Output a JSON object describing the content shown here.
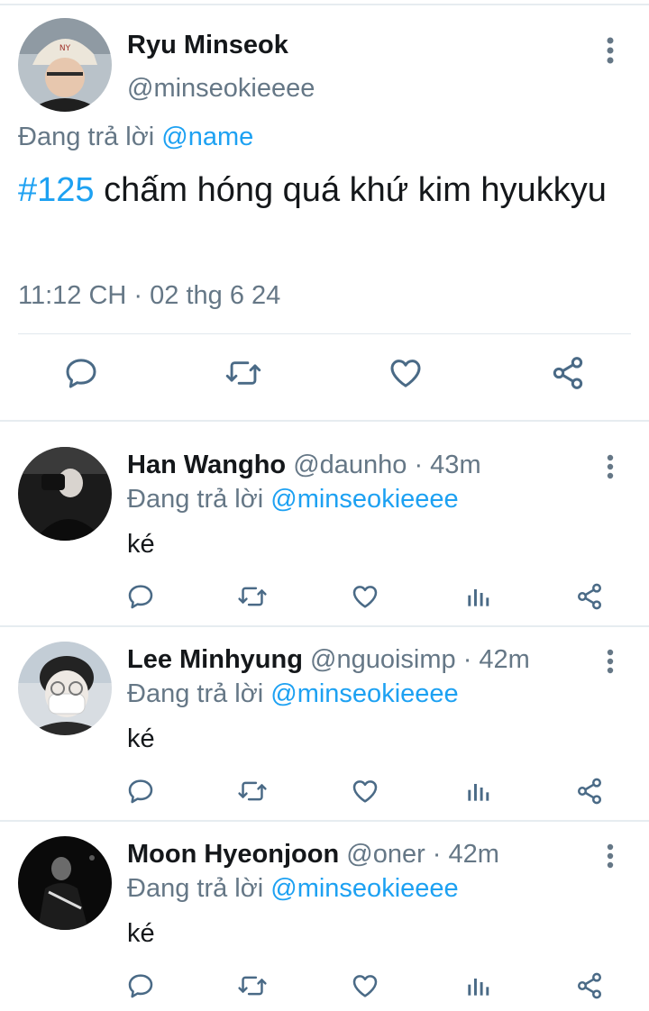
{
  "main_tweet": {
    "author_name": "Ryu Minseok",
    "author_handle": "@minseokieeee",
    "replying_prefix": "Đang trả lời",
    "replying_to": "@name",
    "hashtag": "#125",
    "text": " chấm hóng quá khứ kim hyukkyu",
    "timestamp": "11:12 CH · 02 thg 6 24"
  },
  "replies": [
    {
      "author_name": "Han Wangho",
      "author_handle": "@daunho",
      "age": "· 43m",
      "replying_prefix": "Đang trả lời",
      "replying_to": "@minseokieeee",
      "text": "ké"
    },
    {
      "author_name": "Lee Minhyung",
      "author_handle": "@nguoisimp",
      "age": "· 42m",
      "replying_prefix": "Đang trả lời",
      "replying_to": "@minseokieeee",
      "text": "ké"
    },
    {
      "author_name": "Moon Hyeonjoon",
      "author_handle": "@oner",
      "age": "· 42m",
      "replying_prefix": "Đang trả lời",
      "replying_to": "@minseokieeee",
      "text": "ké"
    }
  ],
  "colors": {
    "link": "#1da1f2",
    "muted": "#657786",
    "text": "#14171a",
    "icon": "#4a6a86",
    "divider": "#e6ecf0"
  },
  "icons": {
    "reply": "reply-icon",
    "retweet": "retweet-icon",
    "like": "heart-icon",
    "analytics": "analytics-icon",
    "share": "share-icon",
    "more": "more-vertical-icon"
  }
}
